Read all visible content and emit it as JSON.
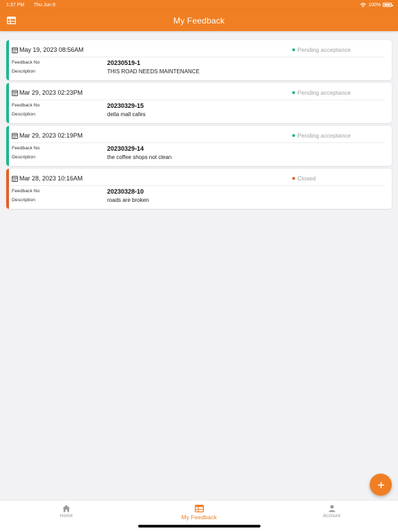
{
  "status_bar": {
    "time": "1:37 PM",
    "day": "Thu Jun 8",
    "battery": "100%"
  },
  "header": {
    "title": "My Feedback",
    "menu_icon": "table-icon"
  },
  "labels": {
    "feedback_no": "Feedback No",
    "description": "Description"
  },
  "colors": {
    "accent": "#f07f24",
    "pending": "#1fb88d",
    "closed": "#e35f2a"
  },
  "feedback_items": [
    {
      "date": "May 19, 2023   08:56AM",
      "status": "Pending acceptance",
      "status_type": "pending",
      "feedback_no": "20230519-1",
      "description": "THIS ROAD NEEDS MAINTENANCE"
    },
    {
      "date": "Mar 29, 2023   02:23PM",
      "status": "Pending acceptance",
      "status_type": "pending",
      "feedback_no": "20230329-15",
      "description": "detla mall cafes"
    },
    {
      "date": "Mar 29, 2023   02:19PM",
      "status": "Pending acceptance",
      "status_type": "pending",
      "feedback_no": "20230329-14",
      "description": "the coffee shops not clean"
    },
    {
      "date": "Mar 28, 2023   10:16AM",
      "status": "Closed",
      "status_type": "closed",
      "feedback_no": "20230328-10",
      "description": "roads are broken"
    }
  ],
  "tabs": [
    {
      "label": "Home",
      "icon": "home-icon"
    },
    {
      "label": "My Feedback",
      "icon": "feedback-icon",
      "active": true
    },
    {
      "label": "Account",
      "icon": "account-icon"
    }
  ]
}
